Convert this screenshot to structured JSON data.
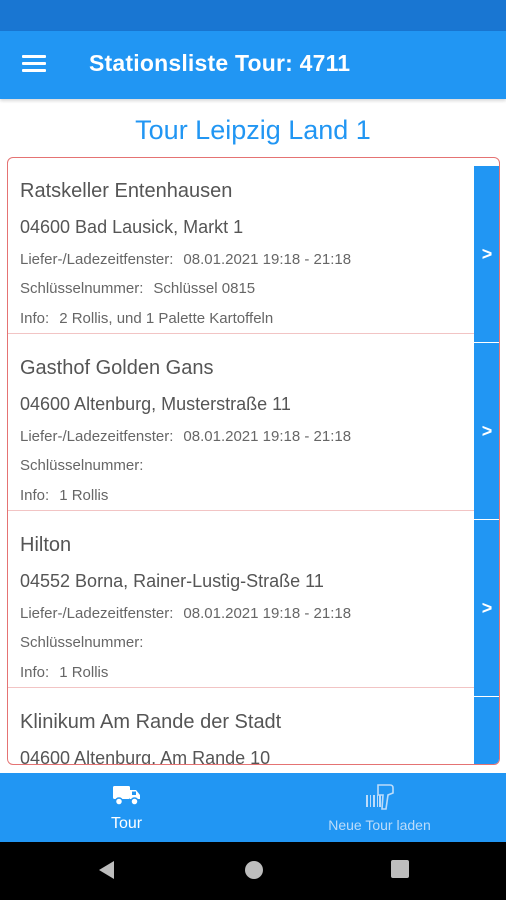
{
  "appbar": {
    "title": "Stationsliste Tour: 4711"
  },
  "tour": {
    "name": "Tour Leipzig Land 1"
  },
  "stations": [
    {
      "name": "Ratskeller Entenhausen",
      "address": "04600 Bad Lausick, Markt 1",
      "window_label": "Liefer-/Ladezeitfenster:",
      "window_value": "08.01.2021 19:18 -  21:18",
      "key_label": "Schlüsselnummer:",
      "key_value": "Schlüssel 0815",
      "info_label": "Info:",
      "info_value": "2 Rollis, und 1 Palette Kartoffeln",
      "arrow": ">"
    },
    {
      "name": "Gasthof Golden Gans",
      "address": "04600 Altenburg, Musterstraße 11",
      "window_label": "Liefer-/Ladezeitfenster:",
      "window_value": "08.01.2021 19:18 -  21:18",
      "key_label": "Schlüsselnummer:",
      "key_value": "",
      "info_label": "Info:",
      "info_value": "1 Rollis",
      "arrow": ">"
    },
    {
      "name": "Hilton",
      "address": "04552 Borna, Rainer-Lustig-Straße 11",
      "window_label": "Liefer-/Ladezeitfenster:",
      "window_value": "08.01.2021 19:18 -  21:18",
      "key_label": "Schlüsselnummer:",
      "key_value": "",
      "info_label": "Info:",
      "info_value": "1 Rollis",
      "arrow": ">"
    },
    {
      "name": "Klinikum Am Rande der Stadt",
      "address": "04600 Altenburg, Am Rande 10"
    }
  ],
  "bottom_nav": {
    "tour_label": "Tour",
    "tour_icon": "truck-icon",
    "load_label": "Neue Tour laden",
    "load_icon": "barcode-scanner-icon"
  },
  "colors": {
    "primary": "#2196f3",
    "status_bar": "#1976d2",
    "list_border": "#e57373"
  }
}
